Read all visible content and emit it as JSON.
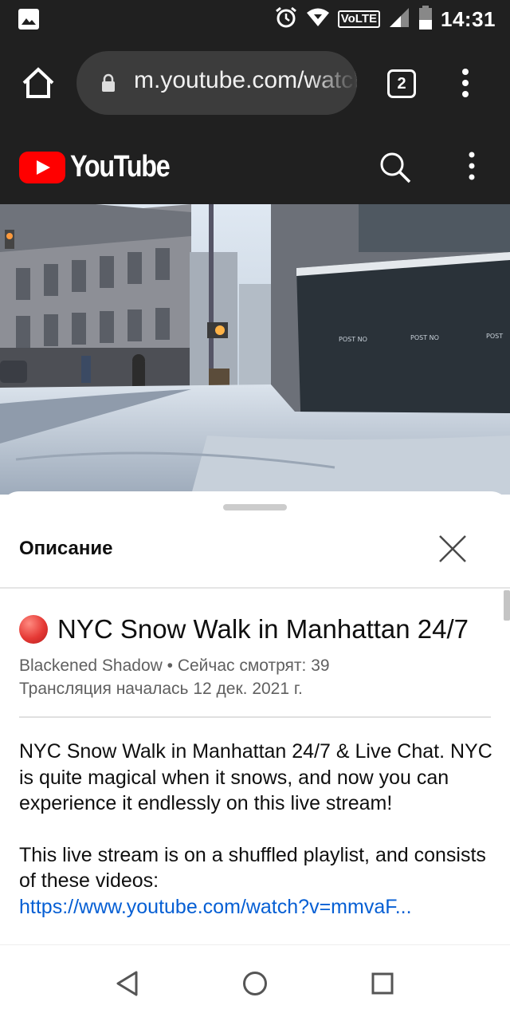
{
  "status_bar": {
    "time": "14:31",
    "network_label": "VoLTE",
    "icons": [
      "image-icon",
      "alarm-icon",
      "wifi-icon",
      "signal-icon",
      "battery-icon"
    ]
  },
  "browser": {
    "url": "m.youtube.com/watch",
    "tab_count": "2"
  },
  "youtube": {
    "logo_text": "YouTube",
    "brand_color": "#ff0000"
  },
  "description_panel": {
    "heading": "Описание",
    "video_title": "NYC Snow Walk in Manhattan 24/7",
    "meta_line1": "Blackened Shadow • Сейчас смотрят: 39",
    "meta_line2": "Трансляция началась 12 дек. 2021 г.",
    "paragraph1": "NYC Snow Walk in Manhattan 24/7 & Live Chat. NYC is quite magical when it snows, and now you can experience it endlessly on this live stream!",
    "paragraph2": "This live stream is on a shuffled playlist, and consists of these videos:",
    "link": "https://www.youtube.com/watch?v=mmvaF...",
    "link_color": "#065fd4"
  }
}
